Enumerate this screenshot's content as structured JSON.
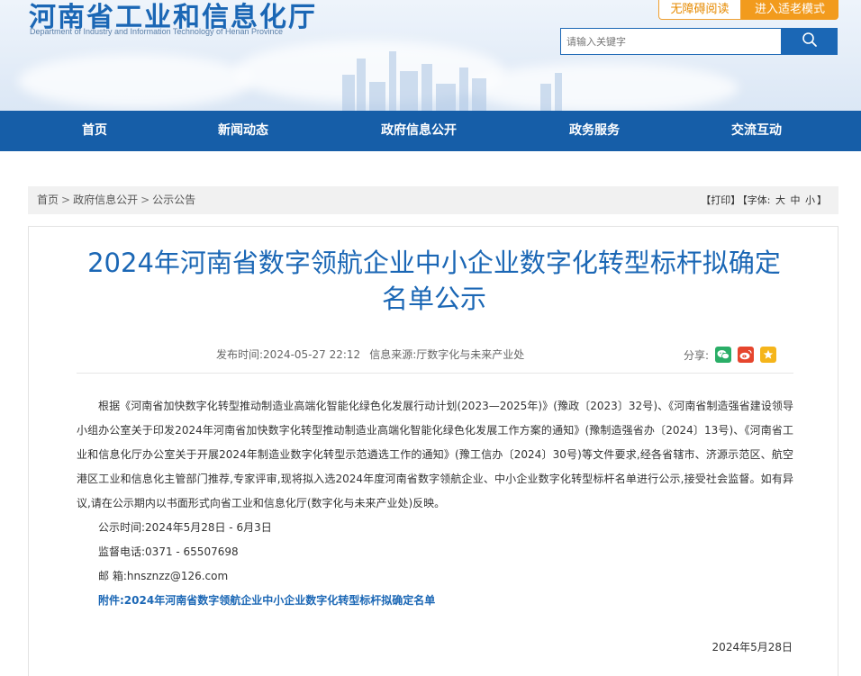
{
  "header": {
    "title": "河南省工业和信息化厅",
    "subtitle": "Department of Industry and Information Technology of Henan Province",
    "accessible_label": "无障碍阅读",
    "elder_label": "进入适老模式",
    "search_placeholder": "请输入关键字"
  },
  "nav": {
    "items": [
      "首页",
      "新闻动态",
      "政府信息公开",
      "政务服务",
      "交流互动"
    ]
  },
  "breadcrumb": {
    "items": [
      "首页",
      "政府信息公开",
      "公示公告"
    ],
    "separator": ">"
  },
  "tools": {
    "print": "【打印】",
    "font_label": "【字体:",
    "font_large": "大",
    "font_medium": "中",
    "font_small": "小",
    "font_close": "】"
  },
  "article": {
    "title": "2024年河南省数字领航企业中小企业数字化转型标杆拟确定名单公示",
    "publish_time": "发布时间:2024-05-27 22:12",
    "source": "信息来源:厅数字化与未来产业处",
    "share_label": "分享:",
    "paragraph": "根据《河南省加快数字化转型推动制造业高端化智能化绿色化发展行动计划(2023—2025年)》(豫政〔2023〕32号)、《河南省制造强省建设领导小组办公室关于印发2024年河南省加快数字化转型推动制造业高端化智能化绿色化发展工作方案的通知》(豫制造强省办〔2024〕13号)、《河南省工业和信息化厅办公室关于开展2024年制造业数字化转型示范遴选工作的通知》(豫工信办〔2024〕30号)等文件要求,经各省辖市、济源示范区、航空港区工业和信息化主管部门推荐,专家评审,现将拟入选2024年度河南省数字领航企业、中小企业数字化转型标杆名单进行公示,接受社会监督。如有异议,请在公示期内以书面形式向省工业和信息化厅(数字化与未来产业处)反映。",
    "period": "公示时间:2024年5月28日 - 6月3日",
    "phone": "监督电话:0371 - 65507698",
    "email": "邮 箱:hnsznzz@126.com",
    "attachment": "附件:2024年河南省数字领航企业中小企业数字化转型标杆拟确定名单",
    "date": "2024年5月28日"
  },
  "colors": {
    "brand_blue": "#1b67b5",
    "nav_blue": "#165ea8",
    "orange": "#f29b1d",
    "wechat": "#2aae67",
    "weibo": "#e6452d",
    "favorite": "#f5b51b"
  },
  "icons": {
    "search": "search-icon",
    "share": [
      "wechat-icon",
      "weibo-icon",
      "favorite-icon"
    ]
  }
}
